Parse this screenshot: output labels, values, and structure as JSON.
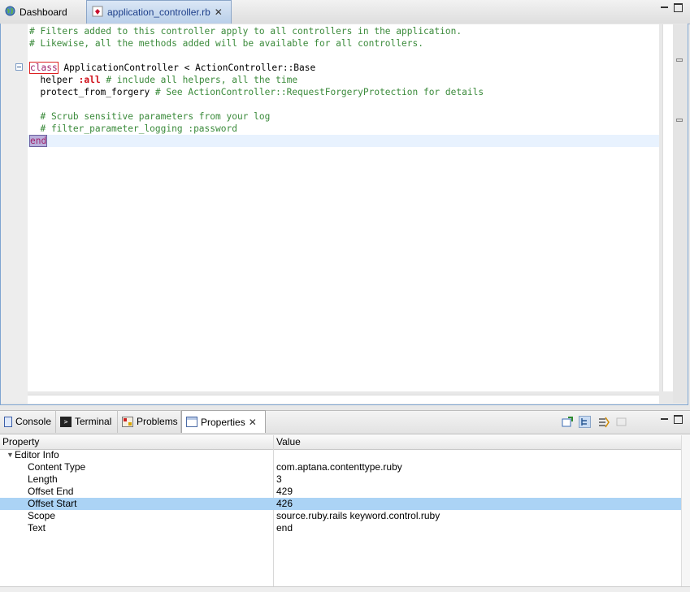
{
  "top_tabs": [
    {
      "label": "Dashboard",
      "icon": "globe-icon",
      "active": false
    },
    {
      "label": "application_controller.rb",
      "icon": "ruby-file-icon",
      "active": true
    }
  ],
  "editor": {
    "lines": [
      {
        "parts": [
          [
            "c",
            "# Filters added to this controller apply to all controllers in the application."
          ]
        ]
      },
      {
        "parts": [
          [
            "c",
            "# Likewise, all the methods added will be available for all controllers."
          ]
        ]
      },
      {
        "parts": []
      },
      {
        "parts": [
          [
            "kw kw-box",
            "class"
          ],
          [
            "const",
            " ApplicationController < ActionController::Base"
          ]
        ]
      },
      {
        "parts": [
          [
            "const",
            "  helper "
          ],
          [
            "sym",
            ":all"
          ],
          [
            "c",
            " # include all helpers, all the time"
          ]
        ]
      },
      {
        "parts": [
          [
            "const",
            "  protect_from_forgery "
          ],
          [
            "c",
            "# See ActionController::RequestForgeryProtection for details"
          ]
        ]
      },
      {
        "parts": []
      },
      {
        "parts": [
          [
            "c",
            "  # Scrub sensitive parameters from your log"
          ]
        ]
      },
      {
        "parts": [
          [
            "c",
            "  # filter_parameter_logging :password"
          ]
        ]
      },
      {
        "parts": [
          [
            "kw kw-sel",
            "end"
          ]
        ]
      }
    ]
  },
  "bottom_tabs": [
    {
      "label": "Console",
      "icon": "console-icon"
    },
    {
      "label": "Terminal",
      "icon": "terminal-icon"
    },
    {
      "label": "Problems",
      "icon": "problems-icon"
    },
    {
      "label": "Properties",
      "icon": "properties-icon",
      "active": true
    }
  ],
  "properties": {
    "header": {
      "property": "Property",
      "value": "Value"
    },
    "group": "Editor Info",
    "rows": [
      {
        "name": "Content Type",
        "value": "com.aptana.contenttype.ruby"
      },
      {
        "name": "Length",
        "value": "3"
      },
      {
        "name": "Offset End",
        "value": "429"
      },
      {
        "name": "Offset Start",
        "value": "426",
        "selected": true
      },
      {
        "name": "Scope",
        "value": "source.ruby.rails keyword.control.ruby"
      },
      {
        "name": "Text",
        "value": "end"
      }
    ]
  },
  "colors": {
    "accent": "#7fa5d1",
    "selection": "#abd3f5",
    "comment": "#3a8a3a",
    "keyword": "#a0226b",
    "symbol": "#d0101a"
  }
}
